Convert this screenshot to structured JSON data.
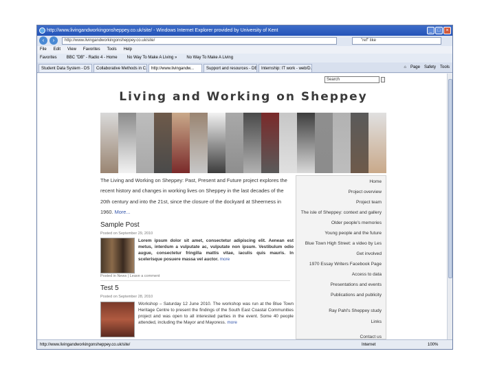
{
  "browser": {
    "title": "http://www.livingandworkingonsheppey.co.uk/site/ - Windows Internet Explorer provided by University of Kent",
    "url": "http://www.livingandworkingonsheppey.co.uk/site/",
    "search_value": "\"ref\" like",
    "menu": [
      "File",
      "Edit",
      "View",
      "Favorites",
      "Tools",
      "Help"
    ],
    "favorites": [
      "Favorites",
      "BBC \"DB\" - Radio 4 - Home",
      "No Way To Make A Living »",
      "No Way To Make A Living"
    ],
    "tabs": [
      "Student Data System - DS",
      "Collaborative Methods in C...",
      "http://www.livingandw...",
      "Support and resources - DE...",
      "Internship: IT work - web/D..."
    ],
    "commands": [
      "Page",
      "Safety",
      "Tools"
    ],
    "status_url": "http://www.livingandworkingonsheppey.co.uk/site/",
    "status_zone": "Internet",
    "status_zoom": "100%"
  },
  "site": {
    "search_placeholder": "Search",
    "title": "Living and Working on Sheppey",
    "banner_colors": [
      "#d9d9d9",
      "#8c8c8c",
      "#bdbdbd",
      "#6e5a4a",
      "#c9a98a",
      "#9a8572",
      "#f2f2f2",
      "#a9a9a9",
      "#4a4a4a",
      "#7a2a2a",
      "#c7c7c7",
      "#3d3d3d",
      "#8e8e8e",
      "#b2b2b2",
      "#5a5a5a",
      "#e0e0e0"
    ],
    "intro": "The Living and Working on Sheppey: Past, Present and Future project explores the recent history and changes in working lives on Sheppey in the last decades of the 20th century and into the 21st, since the closure of the dockyard at Sheerness in 1960.",
    "intro_more": "More...",
    "posts": [
      {
        "title": "Sample Post",
        "date": "Posted on September 29, 2010",
        "body": "Lorem ipsum dolor sit amet, consectetur adipiscing elit. Aenean est metus, interdum a vulputate ac, vulputate non ipsum. Vestibulum odio augue, consectetur fringilla mattis vitae, iaculis quis mauris. In scelerisque posuere massa vel auctor.",
        "more": "more",
        "meta": "Posted in News | Leave a comment"
      },
      {
        "title": "Test 5",
        "date": "Posted on September 28, 2010",
        "body": "Workshop – Saturday 12 June 2010. The workshop was run at the Blue Town Heritage Centre to present the findings of the South East Coastal Communities project and was open to all interested parties in the event. Some 40 people attended, including the Mayor and Mayoress.",
        "more": "more"
      }
    ],
    "sidebar": [
      "Home",
      "Project overview",
      "Project team",
      "The isle of Sheppey: context and gallery",
      "Older people's memories",
      "Young people and the future",
      "Blue Town High Street: a video by Les",
      "Get involved",
      "1970 Essay Writers Facebook Page",
      "Access to data",
      "Presentations and events",
      "Publications and publicity",
      "Ray Pahl's Sheppey study",
      "Links",
      "Contact us"
    ]
  }
}
